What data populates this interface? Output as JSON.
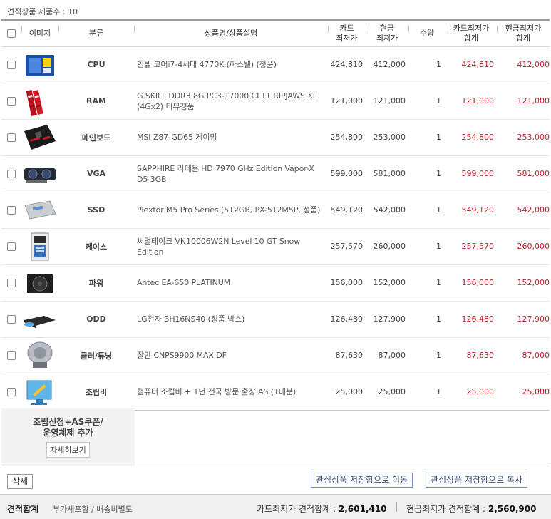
{
  "summary": {
    "label": "견적상품 제품수 : ",
    "count": "10"
  },
  "columns": {
    "image": "이미지",
    "category": "분류",
    "name": "상품명/상품설명",
    "card_line1": "카드",
    "card_line2": "최저가",
    "cash_line1": "현금",
    "cash_line2": "최저가",
    "qty": "수량",
    "card_total_line1": "카드최저가",
    "card_total_line2": "합계",
    "cash_total_line1": "현금최저가",
    "cash_total_line2": "합계"
  },
  "items": [
    {
      "category": "CPU",
      "name": "인텔 코어i7-4세대 4770K (하스웰) (정품)",
      "card": "424,810",
      "cash": "412,000",
      "qty": "1",
      "card_total": "424,810",
      "cash_total": "412,000",
      "icon": "cpu-box-icon"
    },
    {
      "category": "RAM",
      "name": "G.SKILL DDR3 8G PC3-17000 CL11 RIPJAWS XL (4Gx2) 티뮤정품",
      "card": "121,000",
      "cash": "121,000",
      "qty": "1",
      "card_total": "121,000",
      "cash_total": "121,000",
      "icon": "ram-icon"
    },
    {
      "category": "메인보드",
      "name": "MSI Z87-GD65 게이밍",
      "card": "254,800",
      "cash": "253,000",
      "qty": "1",
      "card_total": "254,800",
      "cash_total": "253,000",
      "icon": "motherboard-icon"
    },
    {
      "category": "VGA",
      "name": "SAPPHIRE 라데온 HD 7970 GHz Edition Vapor-X D5 3GB",
      "card": "599,000",
      "cash": "581,000",
      "qty": "1",
      "card_total": "599,000",
      "cash_total": "581,000",
      "icon": "graphics-card-icon"
    },
    {
      "category": "SSD",
      "name": "Plextor M5 Pro Series (512GB, PX-512M5P, 정품)",
      "card": "549,120",
      "cash": "542,000",
      "qty": "1",
      "card_total": "549,120",
      "cash_total": "542,000",
      "icon": "ssd-icon"
    },
    {
      "category": "케이스",
      "name": "써멀테이크 VN10006W2N Level 10 GT Snow Edition",
      "card": "257,570",
      "cash": "260,000",
      "qty": "1",
      "card_total": "257,570",
      "cash_total": "260,000",
      "icon": "pc-case-icon"
    },
    {
      "category": "파워",
      "name": "Antec EA-650 PLATINUM",
      "card": "156,000",
      "cash": "152,000",
      "qty": "1",
      "card_total": "156,000",
      "cash_total": "152,000",
      "icon": "power-supply-icon"
    },
    {
      "category": "ODD",
      "name": "LG전자 BH16NS40 (정품 박스)",
      "card": "126,480",
      "cash": "127,900",
      "qty": "1",
      "card_total": "126,480",
      "cash_total": "127,900",
      "icon": "optical-drive-icon"
    },
    {
      "category": "쿨러/튜닝",
      "name": "잘만 CNPS9900 MAX DF",
      "card": "87,630",
      "cash": "87,000",
      "qty": "1",
      "card_total": "87,630",
      "cash_total": "87,000",
      "icon": "cpu-cooler-icon"
    },
    {
      "category": "조립비",
      "name": "컴퓨터 조립비 + 1년 전국 방문 출장 AS (1대분)",
      "card": "25,000",
      "cash": "25,000",
      "qty": "1",
      "card_total": "25,000",
      "cash_total": "25,000",
      "icon": "assembly-service-icon"
    }
  ],
  "extra": {
    "title_line1": "조립신청+AS쿠폰/",
    "title_line2": "운영체제 추가",
    "detail_button": "자세히보기"
  },
  "actions": {
    "delete": "삭제",
    "move_to_wishlist": "관심상품 저장함으로 이동",
    "copy_to_wishlist": "관심상품 저장함으로 복사"
  },
  "footer": {
    "title": "견적합계",
    "subtitle": "부가세포함 / 배송비별도",
    "card_label": "카드최저가 견적합계 : ",
    "card_total": "2,601,410",
    "cash_label": "현금최저가 견적합계 : ",
    "cash_total": "2,560,900"
  },
  "colors": {
    "price_red": "#c0202a",
    "header_border": "#9a9a9a",
    "footer_bg": "#f0f0f0"
  }
}
